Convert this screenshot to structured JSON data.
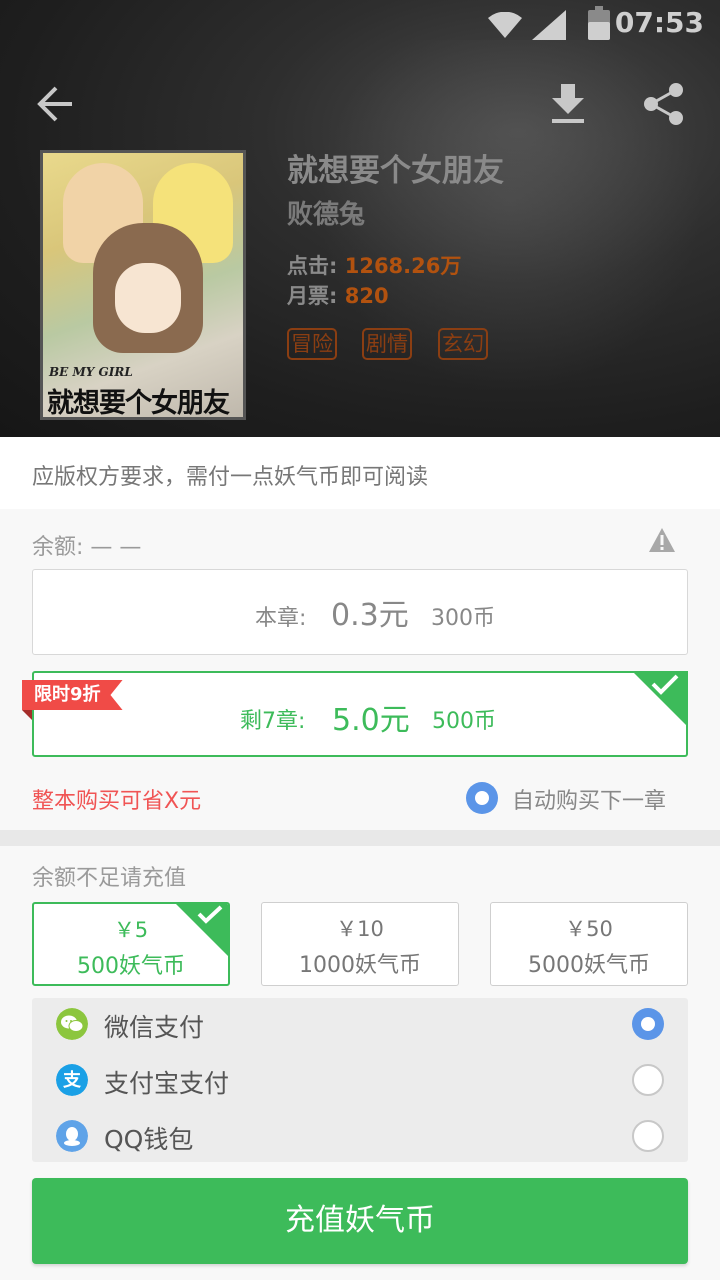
{
  "status_bar": {
    "time": "07:53"
  },
  "book": {
    "title": "就想要个女朋友",
    "author": "败德兔",
    "clicks_label": "点击:",
    "clicks_value": "1268.26万",
    "votes_label": "月票:",
    "votes_value": "820",
    "tags": [
      "冒险",
      "剧情",
      "玄幻"
    ],
    "cover_en": "BE MY GIRL",
    "cover_cn": "就想要个女朋友"
  },
  "notice": "应版权方要求，需付一点妖气币即可阅读",
  "purchase": {
    "balance": "余额: — —",
    "chapter_option": {
      "label": "本章:",
      "price": "0.3元",
      "coins": "300币"
    },
    "rest_option": {
      "label": "剩7章:",
      "price": "5.0元",
      "coins": "500币",
      "badge": "限时9折"
    },
    "save_text": "整本购买可省X元",
    "auto_buy_label": "自动购买下一章"
  },
  "recharge": {
    "title": "余额不足请充值",
    "packages": [
      {
        "price": "￥5",
        "coins": "500妖气币",
        "selected": true
      },
      {
        "price": "￥10",
        "coins": "1000妖气币",
        "selected": false
      },
      {
        "price": "￥50",
        "coins": "5000妖气币",
        "selected": false
      }
    ],
    "payment_methods": [
      {
        "label": "微信支付",
        "icon": "wechat-icon",
        "selected": true
      },
      {
        "label": "支付宝支付",
        "icon": "alipay-icon",
        "selected": false
      },
      {
        "label": "QQ钱包",
        "icon": "qq-icon",
        "selected": false
      }
    ],
    "submit_label": "充值妖气币"
  },
  "colors": {
    "accent_green": "#3dbb5a",
    "radio_blue": "#5b95e8",
    "warning_red": "#f05454",
    "tag_brown": "#8b3e12"
  }
}
